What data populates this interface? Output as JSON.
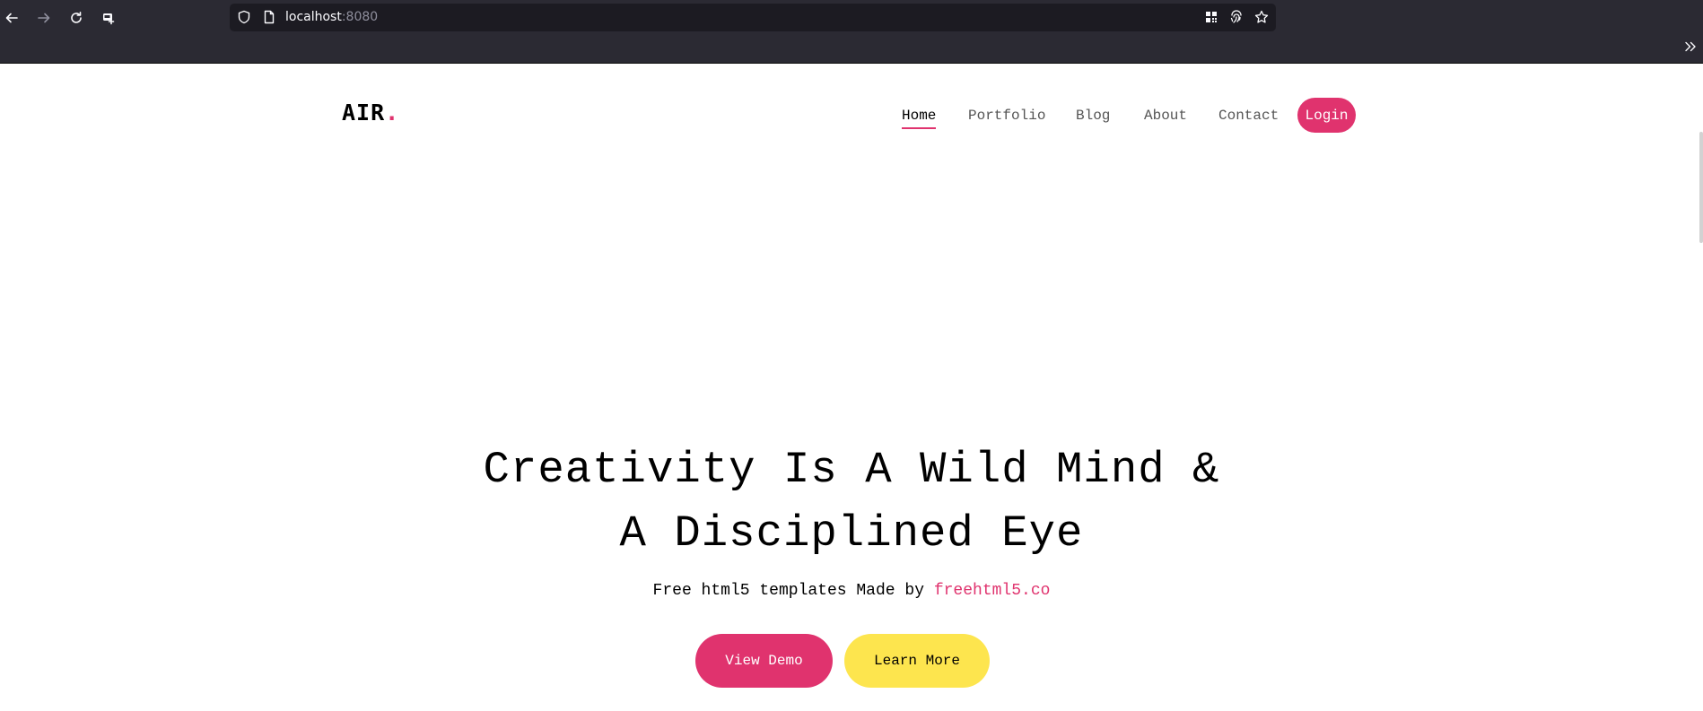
{
  "browser": {
    "url_host": "localhost",
    "url_port": ":8080",
    "icons": [
      "back-arrow-icon",
      "forward-arrow-icon",
      "reload-icon",
      "screenshot-icon",
      "shield-icon",
      "page-icon",
      "qr-grid-icon",
      "fingerprint-icon",
      "bookmark-star-icon",
      "overflow-chevron-icon"
    ]
  },
  "site": {
    "logo_text": "AIR",
    "logo_dot": ".",
    "nav": {
      "home": "Home",
      "portfolio": "Portfolio",
      "blog": "Blog",
      "about": "About",
      "contact": "Contact",
      "login": "Login"
    },
    "hero": {
      "title_line1": "Creativity Is A Wild Mind &",
      "title_line2": "A Disciplined Eye",
      "subtitle_prefix": "Free html5 templates Made by ",
      "subtitle_link": "freehtml5.co",
      "btn_demo": "View Demo",
      "btn_learn": "Learn More"
    }
  },
  "colors": {
    "accent": "#e0336e",
    "secondary": "#fde54e",
    "chrome_bg": "#2b2a33",
    "urlbar_bg": "#1c1b22"
  }
}
